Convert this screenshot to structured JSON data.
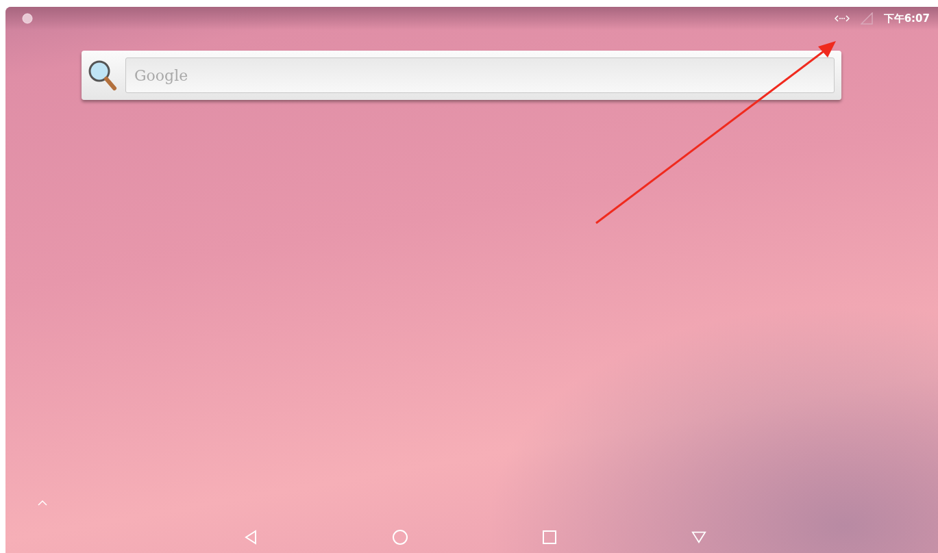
{
  "status_bar": {
    "time": "下午6:07"
  },
  "search_widget": {
    "placeholder": "Google"
  }
}
